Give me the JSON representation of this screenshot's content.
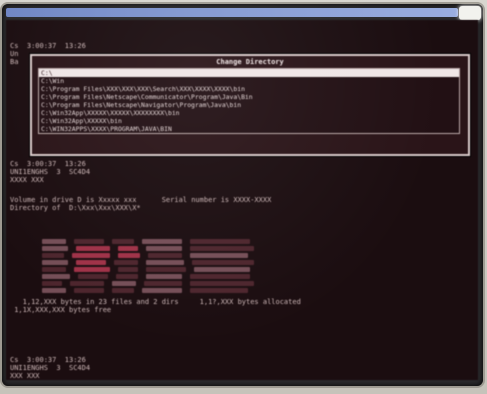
{
  "dialog": {
    "title": "Change Directory",
    "items": [
      {
        "label": "C:\\",
        "selected": true
      },
      {
        "label": "C:\\Win",
        "selected": false
      },
      {
        "label": "C:\\Program Files\\XXX\\XXX\\XXX\\Search\\XXX\\XXXX\\XXXX\\bin",
        "selected": false
      },
      {
        "label": "C:\\Program Files\\Netscape\\Communicator\\Program\\Java\\Bin",
        "selected": false
      },
      {
        "label": "C:\\Program Files\\Netscape\\Navigator\\Program\\Java\\bin",
        "selected": false
      },
      {
        "label": "C:\\Win32App\\XXXXX\\XXXXX\\XXXXXXXX\\bin",
        "selected": false
      },
      {
        "label": "C:\\Win32App\\XXXXX\\bin",
        "selected": false
      },
      {
        "label": "C:\\WIN32APPS\\XXXX\\PROGRAM\\JAVA\\BIN",
        "selected": false
      }
    ]
  },
  "terminal": {
    "block1": "Cs  3:00:37  13:26\nUn\nBa",
    "block2": "Cs  3:00:37  13:26\nUNI1ENGHS  3  SC4D4\nXXXX XXX",
    "block3": "Volume in drive D is Xxxxx xxx      Serial number is XXXX-XXXX\nDirectory of  D:\\Xxx\\Xxx\\XXX\\X*",
    "block4": "   1,12,XXX bytes in 23 files and 2 dirs     1,1?,XXX bytes allocated\n 1,1X,XXX,XXX bytes free",
    "block5": "Cs  3:00:37  13:26\nUNI1ENGHS  3  SC4D4\nXXX XXX"
  }
}
